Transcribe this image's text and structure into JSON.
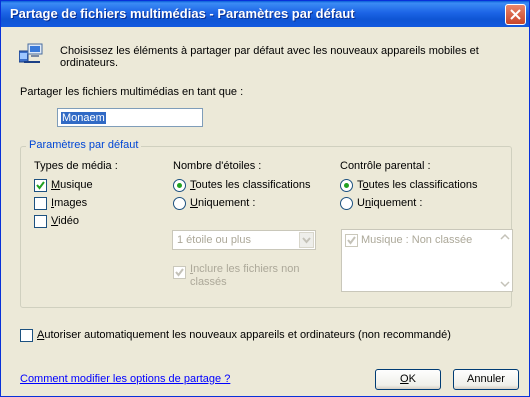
{
  "window": {
    "title": "Partage de fichiers multimédias - Paramètres par défaut"
  },
  "intro": {
    "text": "Choisissez les éléments à partager par défaut avec les nouveaux appareils mobiles et ordinateurs."
  },
  "share_as": {
    "label": "Partager les fichiers multimédias en tant que :",
    "value": "Monaem"
  },
  "defaults_group": {
    "legend": "Paramètres par défaut",
    "media_types": {
      "title": "Types de média :",
      "items": [
        {
          "prefix": "",
          "accel": "M",
          "rest": "usique",
          "checked": true
        },
        {
          "prefix": "",
          "accel": "I",
          "rest": "mages",
          "checked": false
        },
        {
          "prefix": "",
          "accel": "V",
          "rest": "idéo",
          "checked": false
        }
      ]
    },
    "star_rating": {
      "title": "Nombre d'étoiles :",
      "all_accel": "T",
      "all_rest": "outes les classifications",
      "only_accel": "U",
      "only_rest": "niquement :",
      "selected": "all",
      "select_value": "1 étoile ou plus",
      "include_unrated_accel": "I",
      "include_unrated_line1_rest": "nclure les fichiers non",
      "include_unrated_line2": "classés",
      "include_unrated_checked": true
    },
    "parental": {
      "title": "Contrôle parental :",
      "all_prefix": "T",
      "all_accel": "o",
      "all_rest": "utes les classifications",
      "only_prefix": "U",
      "only_accel": "n",
      "only_rest": "iquement :",
      "selected": "all",
      "list_item": "Musique : Non classée",
      "list_item_checked": true
    }
  },
  "auto_allow": {
    "accel": "A",
    "rest": "utoriser automatiquement les nouveaux appareils et ordinateurs (non recommandé)",
    "checked": false
  },
  "footer": {
    "help_link": "Comment modifier les options de partage ?",
    "ok_accel": "O",
    "ok_rest": "K",
    "cancel_label": "Annuler"
  },
  "colors": {
    "title_bar": "#0f55d4",
    "dialog_bg": "#ece9d8",
    "legend": "#0046d5",
    "link": "#0000ff",
    "check": "#21a121"
  }
}
